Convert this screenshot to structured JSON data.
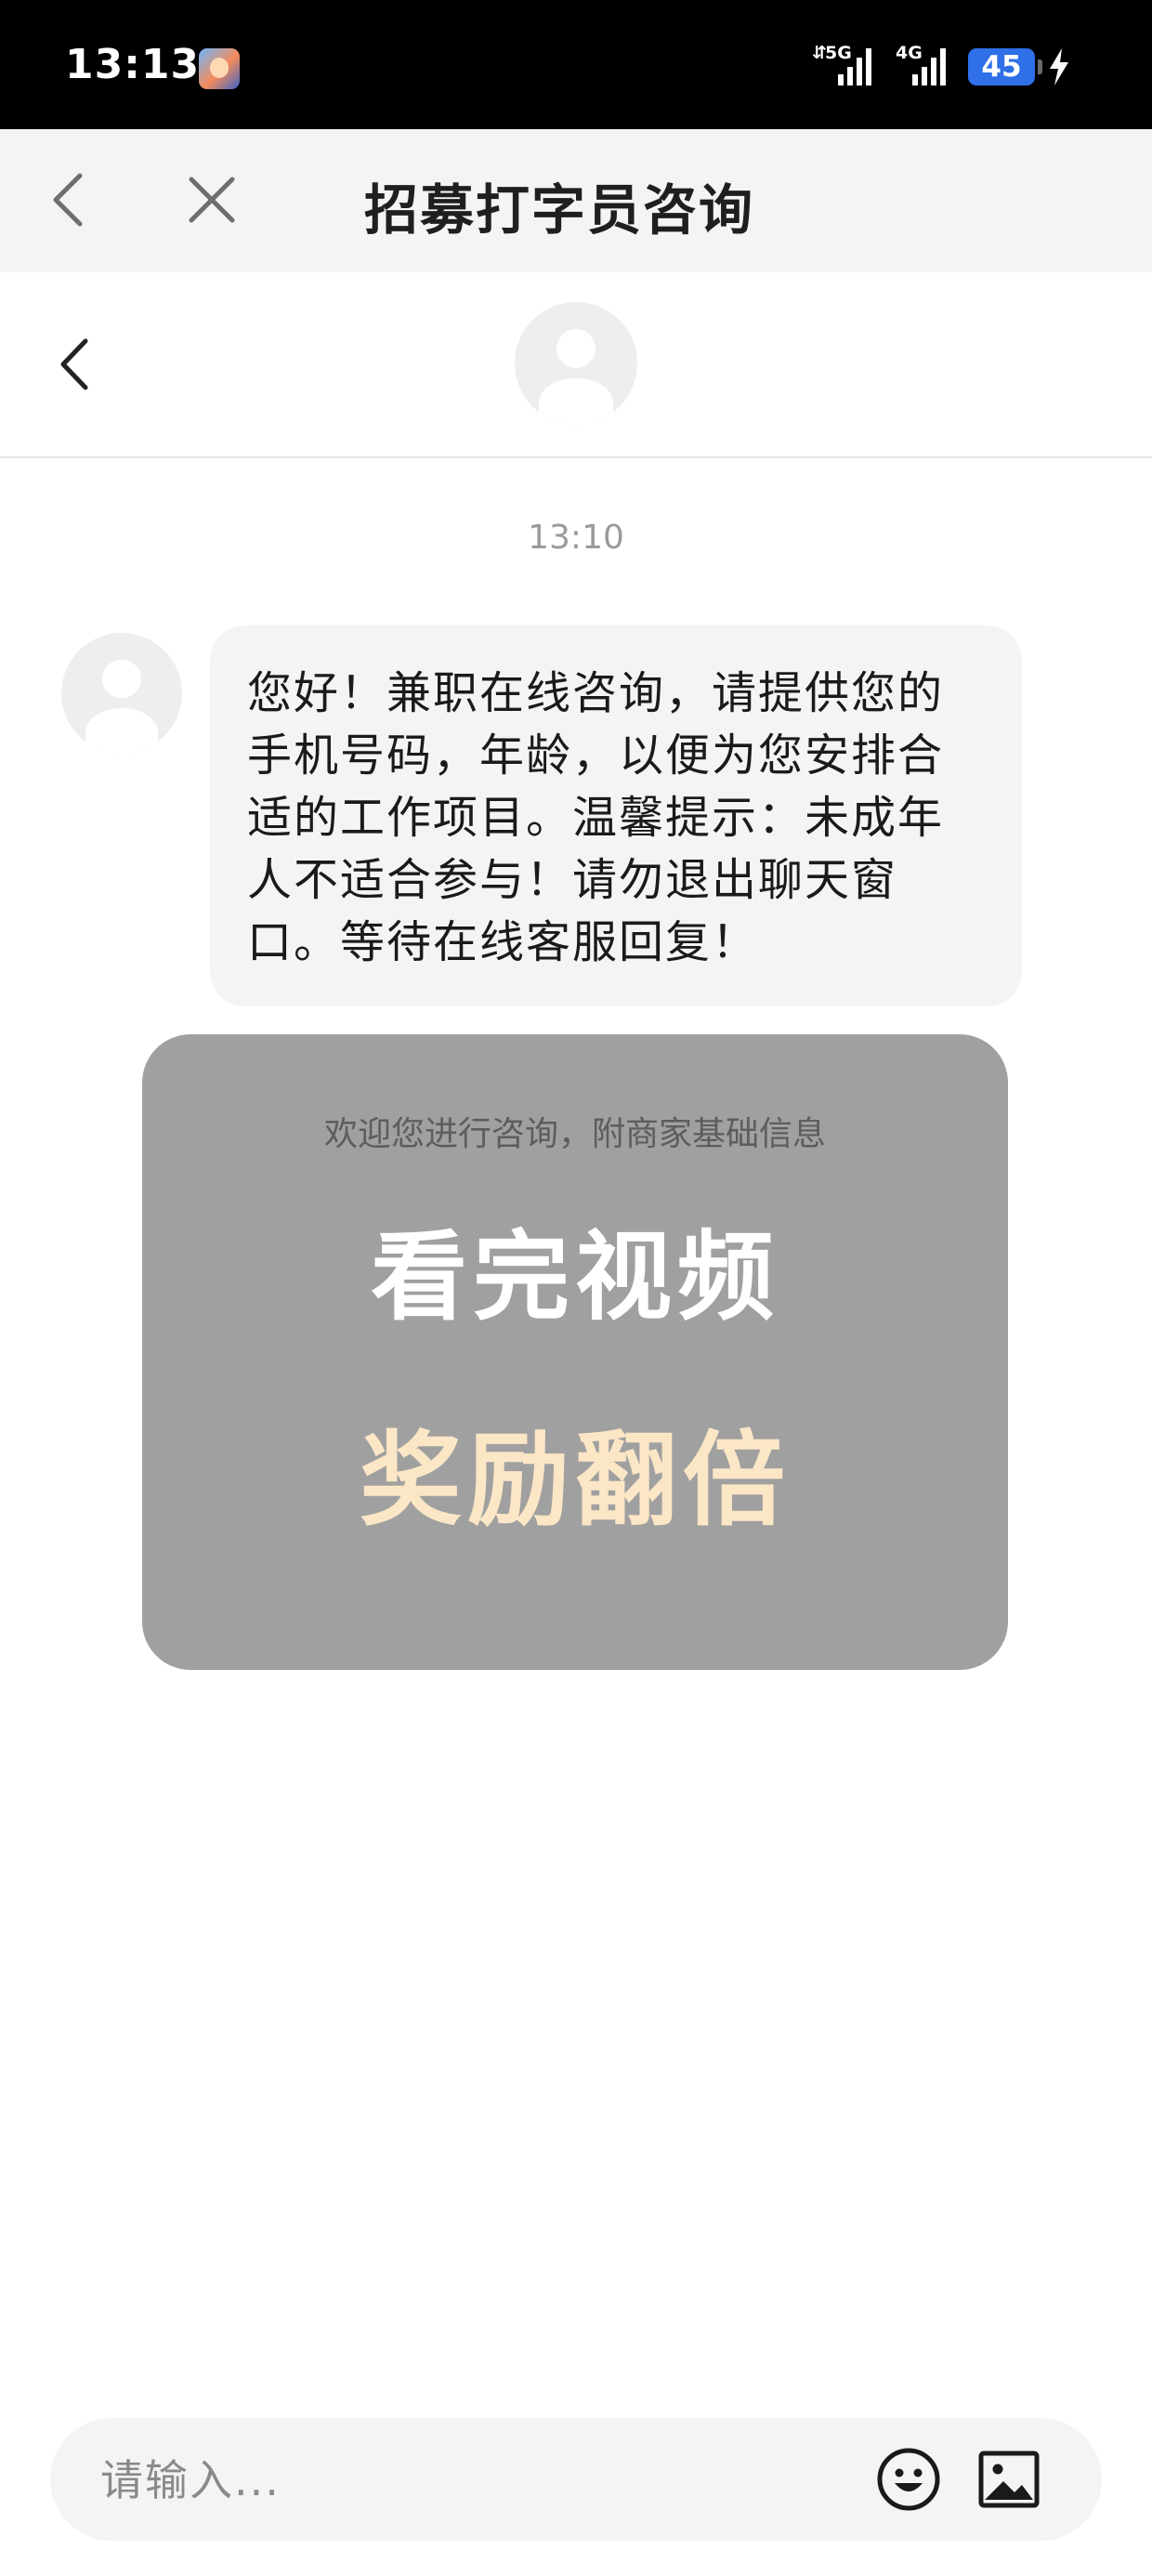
{
  "status_bar": {
    "time": "13:13",
    "signal_1_label": "5G",
    "signal_2_label": "4G",
    "battery": "45"
  },
  "title_bar": {
    "title": "招募打字员咨询",
    "icons": [
      "back-icon",
      "close-icon"
    ]
  },
  "chat": {
    "timestamp": "13:10",
    "message": "您好！兼职在线咨询，请提供您的手机号码，年龄，以便为您安排合适的工作项目。温馨提示：未成年人不适合参与！请勿退出聊天窗口。等待在线客服回复！"
  },
  "promo": {
    "subtitle": "欢迎您进行咨询，附商家基础信息",
    "title": "看完视频",
    "reward": "奖励翻倍",
    "colors": {
      "card": "#a0a0a0",
      "title": "#ffffff",
      "reward": "#fbe6c6"
    }
  },
  "input": {
    "placeholder": "请输入...",
    "icons": [
      "emoji-icon",
      "image-icon"
    ]
  },
  "colors": {
    "battery": "#2f6fe8",
    "bubble": "#f4f4f4"
  }
}
